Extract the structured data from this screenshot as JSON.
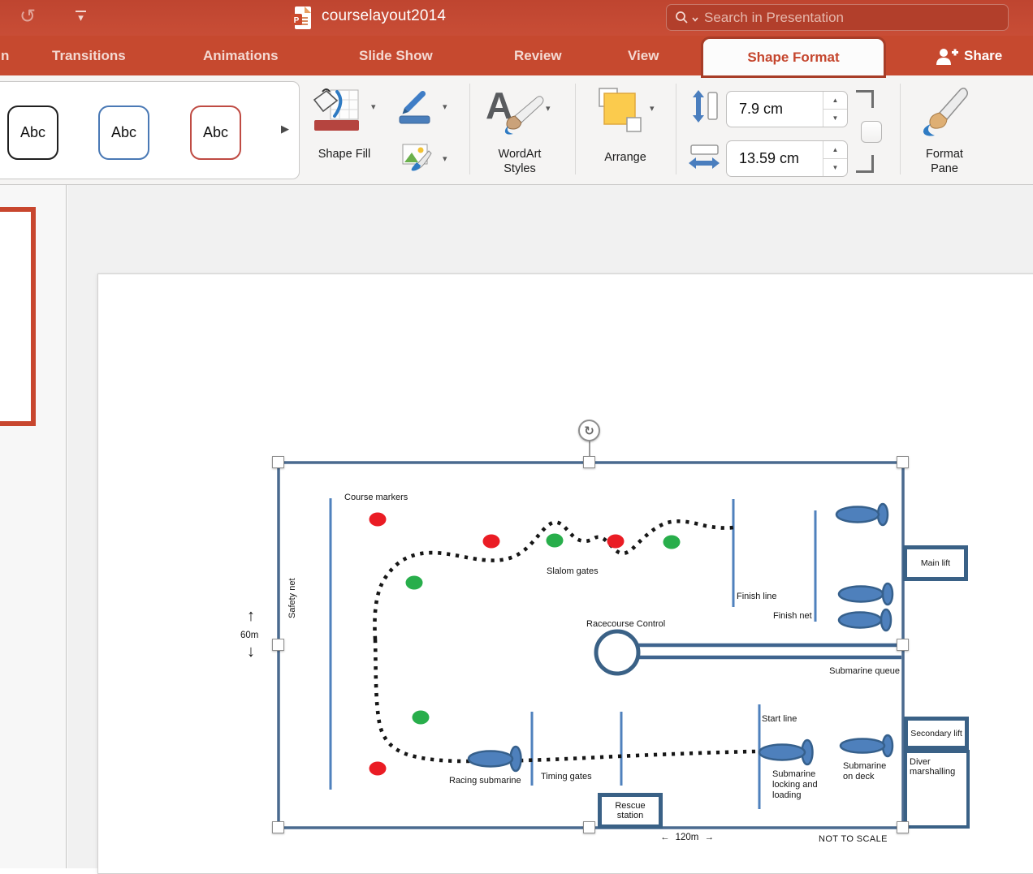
{
  "titlebar": {
    "document_title": "courselayout2014",
    "search_placeholder": "Search in Presentation",
    "share_label": "Share",
    "app_icon_letter": "P"
  },
  "tabs": {
    "partial_left": "n",
    "items": [
      "Transitions",
      "Animations",
      "Slide Show",
      "Review",
      "View"
    ],
    "active": "Shape Format"
  },
  "ribbon": {
    "style_swatches": [
      "Abc",
      "Abc",
      "Abc"
    ],
    "shape_fill_label": "Shape Fill",
    "wordart_label": "WordArt Styles",
    "wordart_icon_letter": "A",
    "arrange_label": "Arrange",
    "format_pane_label": "Format Pane",
    "height_value": "7.9 cm",
    "width_value": "13.59 cm"
  },
  "icons": {
    "undo": "↺",
    "dropdown_caret": "▾",
    "gallery_expand": "▶",
    "stepper_up": "▲",
    "stepper_down": "▼",
    "rotate": "↻",
    "up_arrow": "↑",
    "down_arrow": "↓",
    "left_arrow": "←",
    "right_arrow": "→"
  },
  "colors": {
    "titlebar_red": "#C6492F",
    "active_tab_text": "#C5462E",
    "marker_red": "#EA1C24",
    "marker_green": "#28AE4B",
    "line_blue": "#4F81BD",
    "shape_border_blue": "#3A6186",
    "fill_swatch_red": "#B5443F"
  },
  "diagram": {
    "labels": {
      "course_markers": "Course markers",
      "safety_net": "Safety net",
      "slalom_gates": "Slalom gates",
      "finish_line": "Finish line",
      "finish_net": "Finish net",
      "main_lift": "Main lift",
      "racecourse_control": "Racecourse Control",
      "submarine_queue": "Submarine queue",
      "start_line": "Start line",
      "submarine_locking_and_loading": "Submarine locking and loading",
      "submarine_on_deck": "Submarine on deck",
      "secondary_lift": "Secondary lift",
      "diver_marshalling": "Diver marshalling",
      "racing_submarine": "Racing submarine",
      "timing_gates": "Timing gates",
      "rescue_station": "Rescue station"
    },
    "dimensions": {
      "height": "60m",
      "length": "120m"
    },
    "scale_note": "NOT TO SCALE"
  }
}
